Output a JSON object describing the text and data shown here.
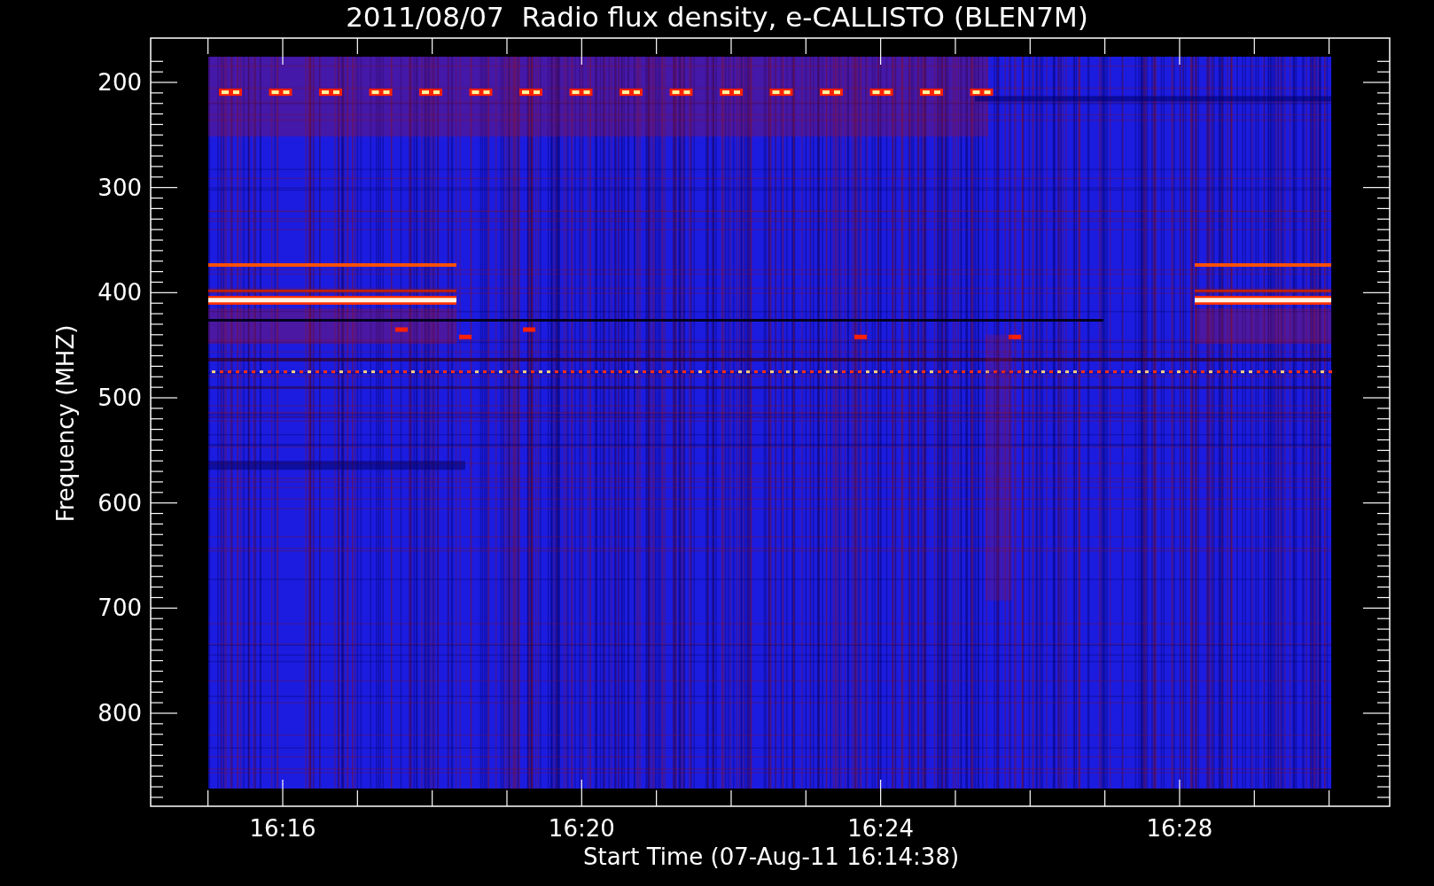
{
  "title": "2011/08/07  Radio flux density, e-CALLISTO (BLEN7M)",
  "y_axis": {
    "title": "Frequency (MHZ)",
    "tick_labels": [
      "200",
      "300",
      "400",
      "500",
      "600",
      "700",
      "800"
    ]
  },
  "x_axis": {
    "title": "Start Time (07-Aug-11 16:14:38)",
    "tick_labels": [
      "16:16",
      "16:20",
      "16:24",
      "16:28"
    ]
  }
}
